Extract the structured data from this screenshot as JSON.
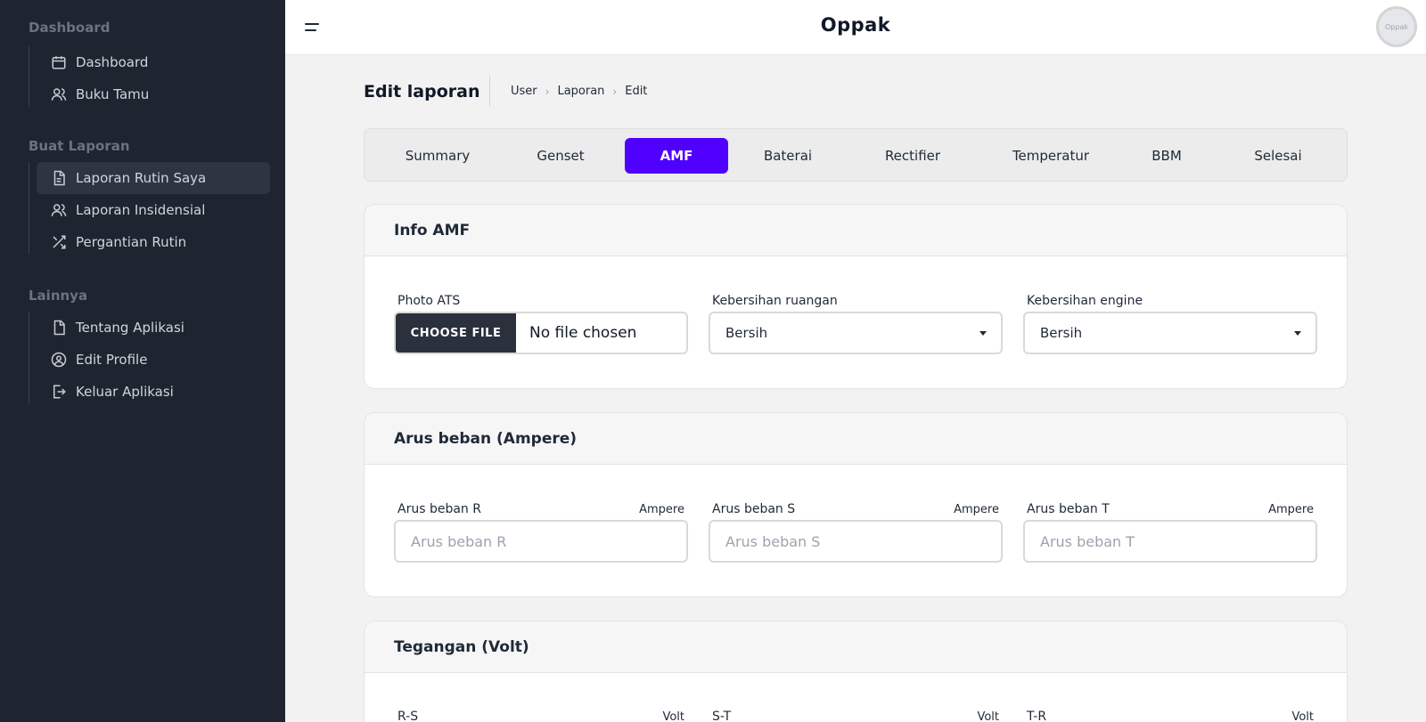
{
  "app": {
    "title": "Oppak",
    "avatar_text": "Oppak"
  },
  "sidebar": {
    "sections": [
      {
        "heading": "Dashboard",
        "items": [
          {
            "label": "Dashboard",
            "icon": "calendar-icon"
          },
          {
            "label": "Buku Tamu",
            "icon": "users-icon"
          }
        ]
      },
      {
        "heading": "Buat Laporan",
        "items": [
          {
            "label": "Laporan Rutin Saya",
            "icon": "document-icon",
            "active": true
          },
          {
            "label": "Laporan Insidensial",
            "icon": "users-icon"
          },
          {
            "label": "Pergantian Rutin",
            "icon": "shuffle-icon"
          }
        ]
      },
      {
        "heading": "Lainnya",
        "items": [
          {
            "label": "Tentang Aplikasi",
            "icon": "file-icon"
          },
          {
            "label": "Edit Profile",
            "icon": "user-circle-icon"
          },
          {
            "label": "Keluar Aplikasi",
            "icon": "logout-icon"
          }
        ]
      }
    ]
  },
  "page": {
    "title": "Edit laporan",
    "breadcrumb": [
      "User",
      "Laporan",
      "Edit"
    ]
  },
  "tabs": {
    "items": [
      "Summary",
      "Genset",
      "AMF",
      "Baterai",
      "Rectifier",
      "Temperatur",
      "BBM",
      "Selesai"
    ],
    "active": "AMF"
  },
  "cards": {
    "info_amf": {
      "title": "Info AMF",
      "photo_label": "Photo ATS",
      "file_button": "CHOOSE FILE",
      "file_status": "No file chosen",
      "ruangan_label": "Kebersihan ruangan",
      "ruangan_value": "Bersih",
      "engine_label": "Kebersihan engine",
      "engine_value": "Bersih"
    },
    "arus": {
      "title": "Arus beban (Ampere)",
      "unit": "Ampere",
      "fields": [
        {
          "label": "Arus beban R",
          "placeholder": "Arus beban R"
        },
        {
          "label": "Arus beban S",
          "placeholder": "Arus beban S"
        },
        {
          "label": "Arus beban T",
          "placeholder": "Arus beban T"
        }
      ]
    },
    "tegangan": {
      "title": "Tegangan (Volt)",
      "unit": "Volt",
      "fields": [
        {
          "label": "R-S"
        },
        {
          "label": "S-T"
        },
        {
          "label": "T-R"
        }
      ]
    }
  },
  "colors": {
    "sidebar_bg": "#1e2530",
    "accent": "#4f00ff",
    "file_button_bg": "#2a303c"
  }
}
